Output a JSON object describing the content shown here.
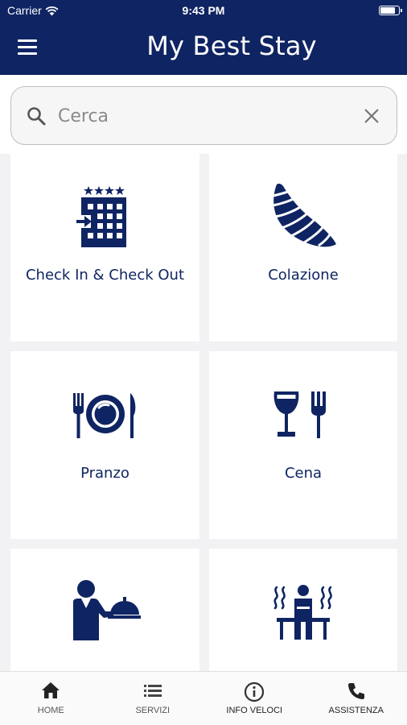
{
  "status_bar": {
    "carrier": "Carrier",
    "time": "9:43 PM",
    "battery_level": 0.85
  },
  "header": {
    "title": "My Best Stay"
  },
  "search": {
    "placeholder": "Cerca",
    "value": ""
  },
  "tiles": [
    {
      "label": "Check In & Check Out",
      "icon": "hotel-checkin-icon"
    },
    {
      "label": "Colazione",
      "icon": "croissant-icon"
    },
    {
      "label": "Pranzo",
      "icon": "plate-cutlery-icon"
    },
    {
      "label": "Cena",
      "icon": "wine-fork-icon"
    },
    {
      "label": "",
      "icon": "waiter-cloche-icon"
    },
    {
      "label": "",
      "icon": "sauna-icon"
    }
  ],
  "tabbar": [
    {
      "label": "HOME",
      "icon": "home-icon"
    },
    {
      "label": "SERVIZI",
      "icon": "list-icon"
    },
    {
      "label": "INFO VELOCI",
      "icon": "info-icon"
    },
    {
      "label": "ASSISTENZA",
      "icon": "phone-icon"
    }
  ],
  "colors": {
    "brand": "#0f2462",
    "background": "#f2f2f4",
    "tile": "#ffffff"
  }
}
